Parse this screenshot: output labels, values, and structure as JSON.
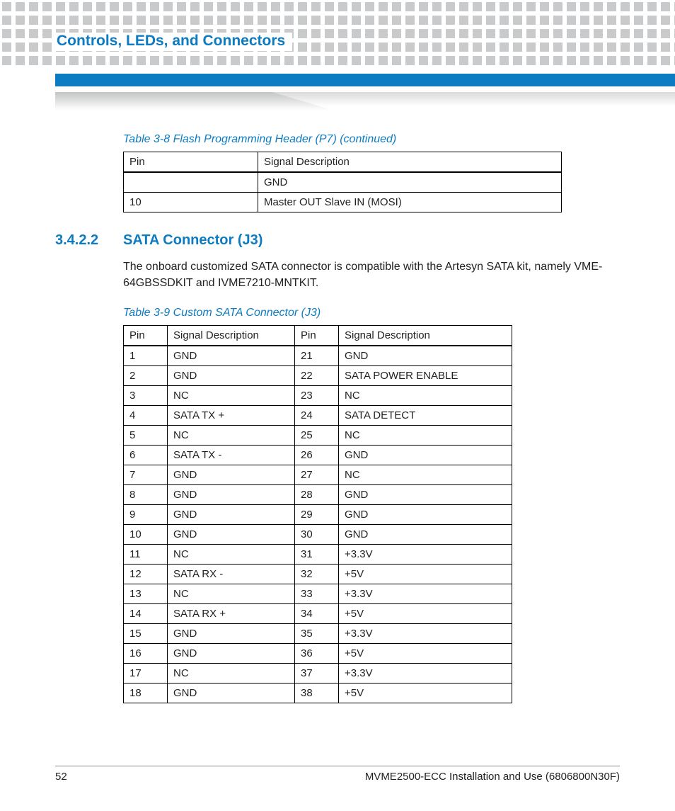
{
  "chapter_title": "Controls, LEDs, and Connectors",
  "table1": {
    "title": "Table 3-8 Flash Programming Header (P7) (continued)",
    "headers": [
      "Pin",
      "Signal Description"
    ],
    "rows": [
      [
        "",
        "GND"
      ],
      [
        "10",
        "Master OUT Slave IN (MOSI)"
      ]
    ]
  },
  "section": {
    "number": "3.4.2.2",
    "title": "SATA Connector (J3)",
    "body": "The onboard customized SATA connector is compatible with the Artesyn SATA kit, namely VME-64GBSSDKIT and IVME7210-MNTKIT."
  },
  "table2": {
    "title": "Table 3-9 Custom SATA Connector (J3)",
    "headers": [
      "Pin",
      "Signal Description",
      "Pin",
      "Signal Description"
    ],
    "rows": [
      [
        "1",
        "GND",
        "21",
        "GND"
      ],
      [
        "2",
        "GND",
        "22",
        "SATA POWER ENABLE"
      ],
      [
        "3",
        "NC",
        "23",
        "NC"
      ],
      [
        "4",
        "SATA TX +",
        "24",
        "SATA DETECT"
      ],
      [
        "5",
        "NC",
        "25",
        "NC"
      ],
      [
        "6",
        "SATA TX -",
        "26",
        "GND"
      ],
      [
        "7",
        "GND",
        "27",
        "NC"
      ],
      [
        "8",
        "GND",
        "28",
        "GND"
      ],
      [
        "9",
        "GND",
        "29",
        "GND"
      ],
      [
        "10",
        "GND",
        "30",
        "GND"
      ],
      [
        "11",
        "NC",
        "31",
        "+3.3V"
      ],
      [
        "12",
        "SATA RX -",
        "32",
        "+5V"
      ],
      [
        "13",
        "NC",
        "33",
        "+3.3V"
      ],
      [
        "14",
        "SATA RX +",
        "34",
        "+5V"
      ],
      [
        "15",
        "GND",
        "35",
        "+3.3V"
      ],
      [
        "16",
        "GND",
        "36",
        "+5V"
      ],
      [
        "17",
        "NC",
        "37",
        "+3.3V"
      ],
      [
        "18",
        "GND",
        "38",
        "+5V"
      ]
    ]
  },
  "footer": {
    "page": "52",
    "doc": "MVME2500-ECC Installation and Use (6806800N30F)"
  }
}
